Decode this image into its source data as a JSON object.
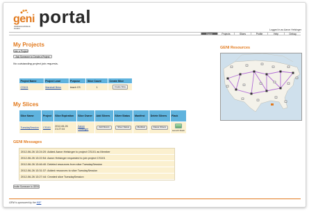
{
  "header": {
    "logo_geni": "geni",
    "logo_sub": "Global Environment for Network Innovations",
    "logo_portal": "portal",
    "logged_in": "Logged in as Aaron Helsinger"
  },
  "nav": {
    "tabs": [
      {
        "label": "Home",
        "active": true
      },
      {
        "label": "Projects",
        "active": false
      },
      {
        "label": "Slices",
        "active": false
      },
      {
        "label": "Profile",
        "active": false
      },
      {
        "label": "Help",
        "active": false
      },
      {
        "label": "Debug",
        "active": false
      }
    ]
  },
  "projects": {
    "title": "My Projects",
    "join_button": "Join a Project",
    "ask_button": "Ask Someone to Create a Project",
    "no_requests": "No outstanding project join requests.",
    "columns": [
      "Project Name",
      "Project Lead",
      "Purpose",
      "Slice Count",
      "Create Slice"
    ],
    "rows": [
      {
        "name": "CS101",
        "lead": "Marshall Brinn",
        "purpose": "teach CS",
        "count": "1",
        "create": "Create Slice"
      }
    ]
  },
  "slices": {
    "title": "My Slices",
    "columns": [
      "Slice Name",
      "Project",
      "Slice Expiration",
      "Slice Owner",
      "Add Slivers",
      "Sliver Status",
      "Manifest",
      "Delete Slivers",
      "Flack"
    ],
    "rows": [
      {
        "name": "TuesdaySession",
        "project": "CS101",
        "expiration_date": "2012-06-26",
        "expiration_time": "21:27:44",
        "owner_first": "Aaron",
        "owner_last": "Helsinger",
        "add": "Add Slivers",
        "status": "Sliver Status",
        "manifest": "Manifest",
        "delete": "Delete Slivers",
        "flack": "Launch Flack"
      }
    ]
  },
  "messages": {
    "title": "GENI Messages",
    "items": [
      "2012-06-26 13:24:20:  Added Aaron Helsinger to project CS101 as Member",
      "2012-06-26 13:22:54:  Aaron Helsinger requested to join project CS101",
      "2012-06-26 13:46:40:  Deleted resources from slice TuesdaySession",
      "2012-06-26 13:31:37:  Added resources to slice TuesdaySession",
      "2012-06-26 13:27:44:  Created slice TuesdaySession"
    ],
    "invite_button": "Invite Someone to GENI"
  },
  "resources": {
    "title": "GENI Resources"
  },
  "footer": {
    "text_prefix": "GENI is sponsored by the ",
    "nsf_link": "NSF"
  },
  "colors": {
    "accent": "#e27a1e",
    "table_header": "#5fb3de",
    "table_row": "#fbf0cf",
    "link": "#1646a8"
  }
}
